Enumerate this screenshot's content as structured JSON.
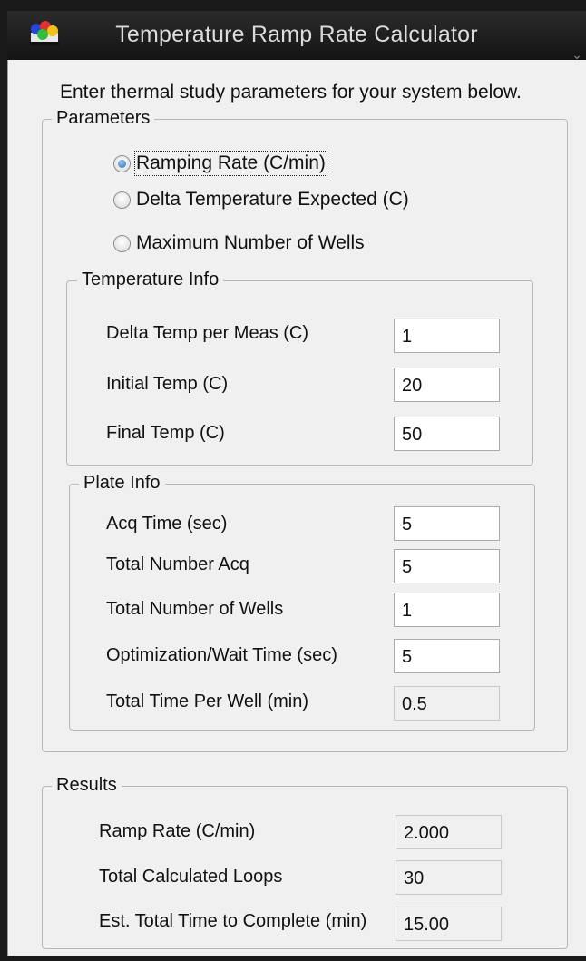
{
  "window": {
    "title": "Temperature Ramp Rate Calculator"
  },
  "intro_text": "Enter thermal study parameters for your system below.",
  "parameters": {
    "legend": "Parameters",
    "options": [
      {
        "label": "Ramping Rate (C/min)",
        "selected": true
      },
      {
        "label": "Delta Temperature Expected (C)",
        "selected": false
      },
      {
        "label": "Maximum Number of Wells",
        "selected": false
      }
    ]
  },
  "temperature_info": {
    "legend": "Temperature Info",
    "fields": [
      {
        "label": "Delta Temp per Meas (C)",
        "value": "1"
      },
      {
        "label": "Initial Temp (C)",
        "value": "20"
      },
      {
        "label": "Final Temp (C)",
        "value": "50"
      }
    ]
  },
  "plate_info": {
    "legend": "Plate Info",
    "fields": [
      {
        "label": "Acq Time (sec)",
        "value": "5"
      },
      {
        "label": "Total Number Acq",
        "value": "5"
      },
      {
        "label": "Total Number of Wells",
        "value": "1"
      },
      {
        "label": "Optimization/Wait Time (sec)",
        "value": "5"
      },
      {
        "label": "Total Time Per Well (min)",
        "value": "0.5",
        "readonly": true
      }
    ]
  },
  "results": {
    "legend": "Results",
    "fields": [
      {
        "label": "Ramp Rate (C/min)",
        "value": "2.000"
      },
      {
        "label": "Total Calculated Loops",
        "value": "30"
      },
      {
        "label": "Est. Total Time to Complete (min)",
        "value": "15.00"
      }
    ]
  }
}
